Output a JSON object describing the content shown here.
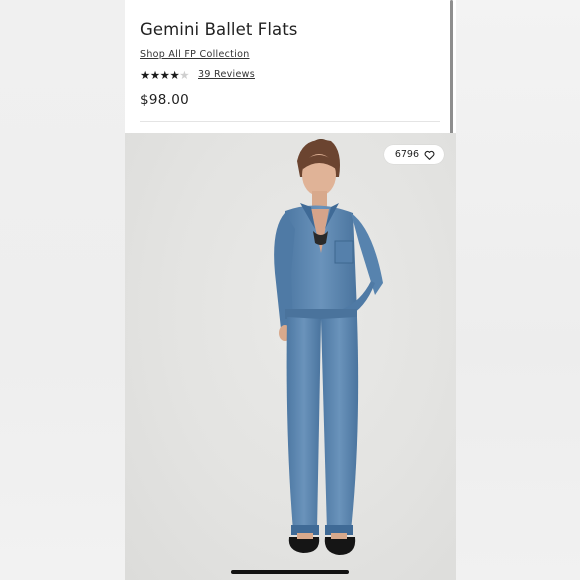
{
  "product": {
    "title": "Gemini Ballet Flats",
    "collection_link": "Shop All FP Collection",
    "rating": 4,
    "rating_max": 5,
    "reviews_link": "39 Reviews",
    "price": "$98.00"
  },
  "gallery": {
    "favorite_count": "6796",
    "favorite_icon": "heart-icon"
  },
  "colors": {
    "background": "#ffffff",
    "text": "#222222",
    "star_filled": "#1a1a1a",
    "star_empty": "#cfcfcf",
    "denim": "#5b86b0"
  }
}
